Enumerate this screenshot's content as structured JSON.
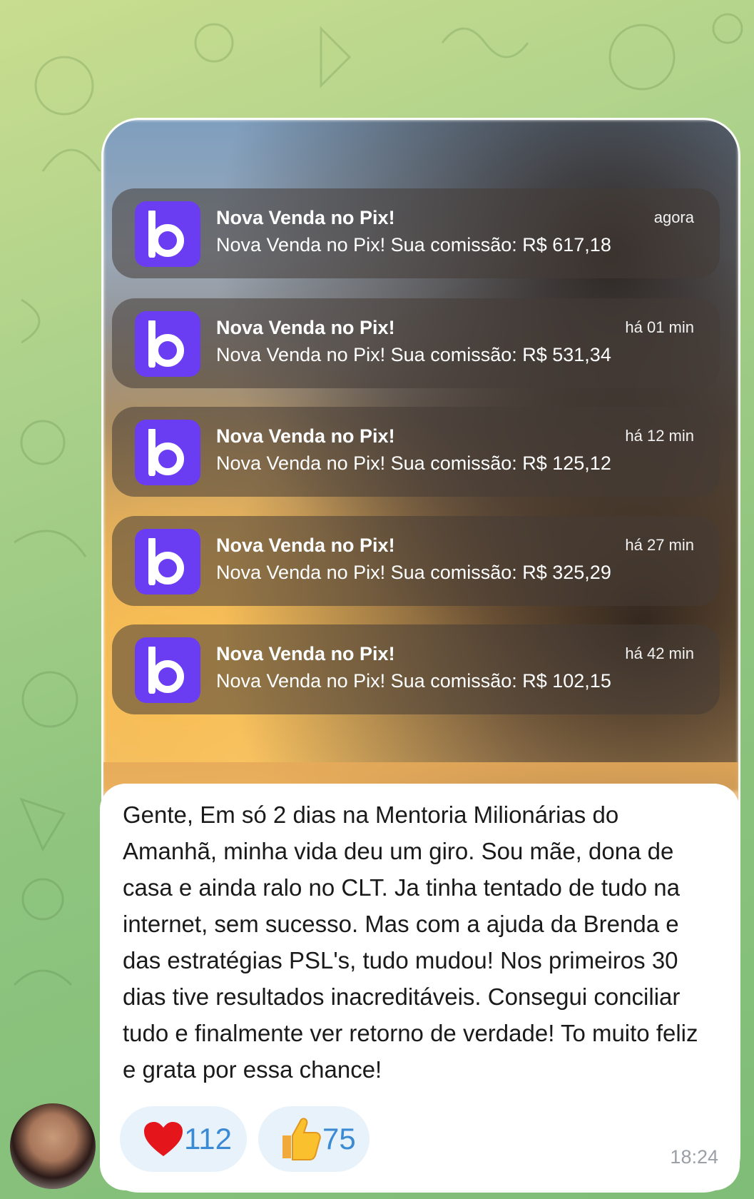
{
  "notifications": [
    {
      "title": "Nova Venda no Pix!",
      "body": "Nova Venda no Pix! Sua comissão: R$ 617,18",
      "time": "agora"
    },
    {
      "title": "Nova Venda no Pix!",
      "body": "Nova Venda no Pix! Sua comissão: R$ 531,34",
      "time": "há 01 min"
    },
    {
      "title": "Nova Venda no Pix!",
      "body": "Nova Venda no Pix! Sua comissão: R$ 125,12",
      "time": "há 12 min"
    },
    {
      "title": "Nova Venda no Pix!",
      "body": "Nova Venda no Pix! Sua comissão: R$ 325,29",
      "time": "há 27 min"
    },
    {
      "title": "Nova Venda no Pix!",
      "body": "Nova Venda no Pix! Sua comissão: R$ 102,15",
      "time": "há 42 min"
    }
  ],
  "app_icon_letter": "b",
  "app_icon_color": "#6a3df3",
  "message": {
    "text": "Gente, Em só 2 dias na Mentoria Milionárias do Amanhã, minha vida deu um giro. Sou mãe, dona de casa e ainda ralo no CLT. Ja tinha tentado de tudo na internet, sem sucesso. Mas com a ajuda da Brenda e das estratégias PSL's, tudo mudou! Nos primeiros 30 dias tive resultados inacreditáveis. Consegui conciliar tudo e finalmente ver retorno de verdade! To muito feliz e grata por essa chance!",
    "time": "18:24"
  },
  "reactions": [
    {
      "icon": "heart-icon",
      "count": "112"
    },
    {
      "icon": "thumbs-up-icon",
      "count": "75"
    }
  ]
}
